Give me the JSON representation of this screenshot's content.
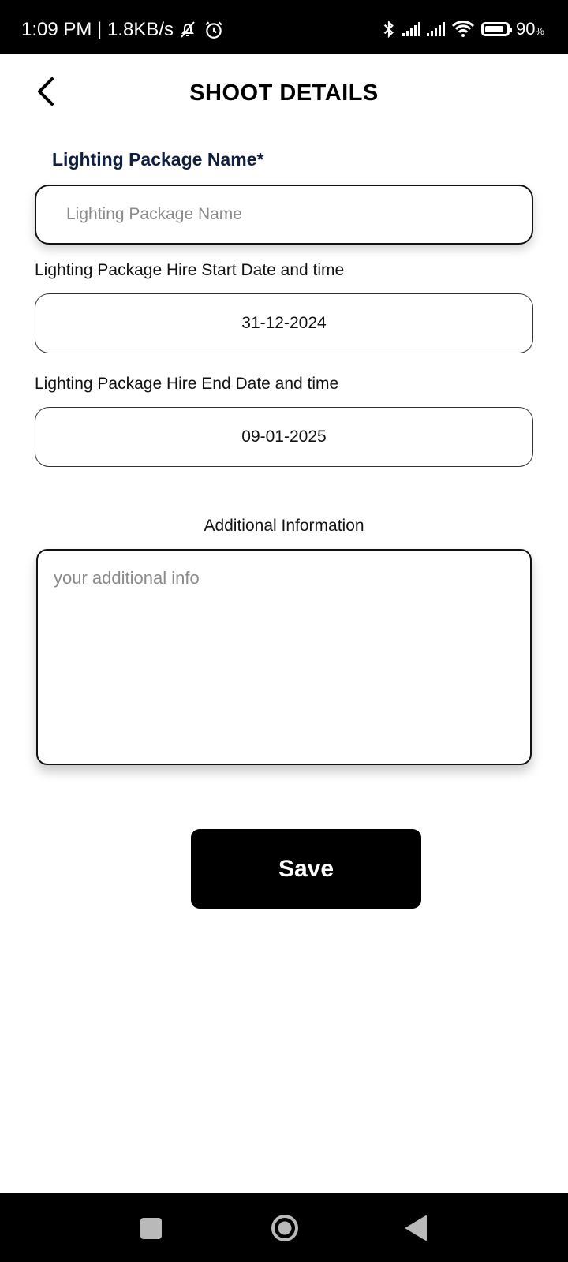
{
  "status_bar": {
    "time_speed": "1:09 PM | 1.8KB/s",
    "icons": [
      "bell-off-icon",
      "alarm-icon",
      "bluetooth-icon",
      "signal-icon",
      "signal-icon",
      "wifi-icon",
      "battery-icon"
    ],
    "battery": "90",
    "battery_unit": "%",
    "battery_level": 0.9
  },
  "header": {
    "title": "SHOOT DETAILS",
    "back_icon": "chevron-left-icon"
  },
  "form": {
    "package_name": {
      "label": "Lighting Package Name*",
      "placeholder": "Lighting Package Name",
      "value": ""
    },
    "start_date": {
      "label": "Lighting Package Hire Start Date and time",
      "value": "31-12-2024"
    },
    "end_date": {
      "label": "Lighting Package Hire End Date and time",
      "value": "09-01-2025"
    },
    "additional_info": {
      "label": "Additional Information",
      "placeholder": "your additional info",
      "value": ""
    },
    "save_label": "Save"
  },
  "nav_bar": {
    "icons": [
      "recents-icon",
      "home-icon",
      "back-icon"
    ]
  }
}
